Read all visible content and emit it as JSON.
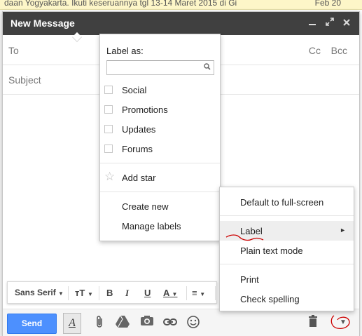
{
  "background": {
    "email_snippet": "daan Yogyakarta. Ikuti keseruannya tgl 13-14 Maret 2015 di Gi",
    "email_date": "Feb 20"
  },
  "compose": {
    "title": "New Message",
    "to_label": "To",
    "cc_label": "Cc",
    "bcc_label": "Bcc",
    "subject_placeholder": "Subject",
    "send_label": "Send"
  },
  "format_bar": {
    "font": "Sans Serif",
    "size": "тT",
    "bold": "B",
    "italic": "I",
    "underline": "U",
    "text_color": "A",
    "align": "≡"
  },
  "label_menu": {
    "title": "Label as:",
    "search_value": "",
    "labels": [
      "Social",
      "Promotions",
      "Updates",
      "Forums"
    ],
    "add_star": "Add star",
    "create_new": "Create new",
    "manage_labels": "Manage labels"
  },
  "more_menu": {
    "items": {
      "default_fullscreen": "Default to full-screen",
      "label": "Label",
      "plain_text": "Plain text mode",
      "print": "Print",
      "check_spelling": "Check spelling"
    },
    "highlighted": "Label"
  },
  "colors": {
    "header": "#404040",
    "send": "#4d90fe",
    "annotation": "#cc0000"
  },
  "icons": [
    "minimize-icon",
    "expand-icon",
    "close-icon",
    "attach-icon",
    "drive-icon",
    "photo-icon",
    "link-icon",
    "emoji-icon",
    "trash-icon",
    "more-options-icon",
    "star-icon",
    "search-icon",
    "submenu-arrow-icon"
  ]
}
